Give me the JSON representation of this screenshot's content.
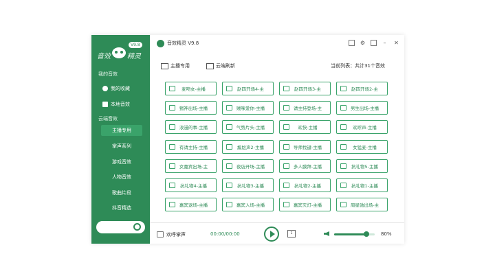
{
  "app": {
    "title": "音效精灵 V9.8",
    "logo_text_left": "音效",
    "logo_text_right": "精灵",
    "logo_version": "V9.8"
  },
  "sidebar": {
    "my_section": "我的音效",
    "my_items": [
      {
        "label": "我的收藏",
        "icon": "star-icon"
      },
      {
        "label": "本地音效",
        "icon": "folder-icon"
      }
    ],
    "cloud_section": "云端音效",
    "cloud_items": [
      {
        "label": "主播专用",
        "active": true
      },
      {
        "label": "掌声系列",
        "active": false
      },
      {
        "label": "游戏音效",
        "active": false
      },
      {
        "label": "人物音效",
        "active": false
      },
      {
        "label": "歌曲片段",
        "active": false
      },
      {
        "label": "抖音精选",
        "active": false
      }
    ]
  },
  "toolbar": {
    "anchor": "主播专用",
    "refresh": "云端刷新",
    "list_info": "当前列表：共计31个音效"
  },
  "sounds": [
    "麦吻女-主播",
    "赵四开场4-主",
    "赵四开场3-主",
    "赵四开场2-主",
    "猪神出场-主播",
    "贼咪爱你-主播",
    "请主持登场-主",
    "男生出场-主播",
    "浪漫的事-主播",
    "气势片头-主播",
    "欢快-主播",
    "欢呼声-主播",
    "有请主持-主播",
    "尴尬声2-主播",
    "导师找键-主播",
    "女猛麦-主播",
    "女嘉宾出场-主",
    "夜店开场-主播",
    "多人膜拜-主播",
    "抗礼物5-主播",
    "抗礼物4-主播",
    "抗礼物3-主播",
    "抗礼物2-主播",
    "抗礼物1-主播",
    "嘉宾退场-主播",
    "嘉宾入场-主播",
    "嘉宾灭灯-主播",
    "周星驰出场-主"
  ],
  "player": {
    "now_playing": "欢呼掌声",
    "time": "00:00/00:00",
    "mode_label": "1",
    "volume": 80,
    "volume_label": "80%"
  },
  "colors": {
    "accent": "#2e8b57",
    "sidebar_bg": "#2e8b57",
    "button_border": "#3aa36a"
  }
}
